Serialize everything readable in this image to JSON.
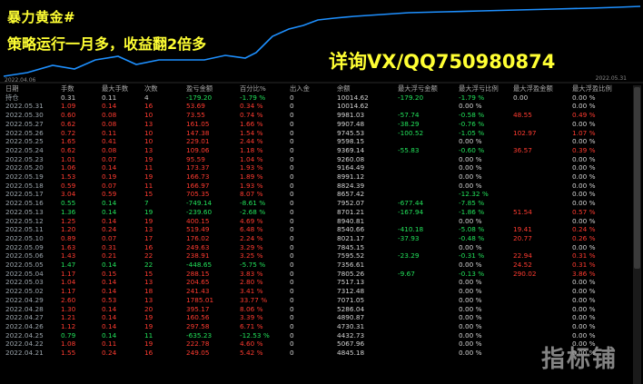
{
  "chart": {
    "title": "暴力黄金#",
    "subtitle": "策略运行一月多，收益翻2倍多",
    "contact": "详询VX/QQ750980874",
    "date_start": "2022.04.06",
    "date_end": "2022.05.31"
  },
  "table": {
    "headers": [
      "日期",
      "手数",
      "最大手数",
      "次数",
      "盈亏金额",
      "百分比%",
      "出入金",
      "余额",
      "最大浮亏金额",
      "最大浮亏比例",
      "最大浮盈金额",
      "最大浮盈比例"
    ],
    "rows": [
      [
        "持仓",
        "0.31",
        "0.11",
        "4",
        "-179.20",
        "-1.79 %",
        "0",
        "10014.62",
        "-179.20",
        "-1.79 %",
        "0.00",
        "0.00 %"
      ],
      [
        "2022.05.31",
        "1.09",
        "0.14",
        "16",
        "53.69",
        "0.34 %",
        "0",
        "10014.62",
        "",
        "0.00 %",
        "",
        "0.00 %"
      ],
      [
        "2022.05.30",
        "0.60",
        "0.08",
        "10",
        "73.55",
        "0.74 %",
        "0",
        "9981.03",
        "-57.74",
        "-0.58 %",
        "48.55",
        "0.49 %"
      ],
      [
        "2022.05.27",
        "0.62",
        "0.08",
        "13",
        "161.05",
        "1.66 %",
        "0",
        "9907.48",
        "-38.29",
        "-0.76 %",
        "",
        "0.00 %"
      ],
      [
        "2022.05.26",
        "0.72",
        "0.11",
        "10",
        "147.38",
        "1.54 %",
        "0",
        "9745.53",
        "-100.52",
        "-1.05 %",
        "102.97",
        "1.07 %"
      ],
      [
        "2022.05.25",
        "1.65",
        "0.41",
        "10",
        "229.01",
        "2.44 %",
        "0",
        "9598.15",
        "",
        "0.00 %",
        "",
        "0.00 %"
      ],
      [
        "2022.05.24",
        "0.62",
        "0.08",
        "13",
        "109.06",
        "1.18 %",
        "0",
        "9369.14",
        "-55.83",
        "-0.60 %",
        "36.57",
        "0.39 %"
      ],
      [
        "2022.05.23",
        "1.01",
        "0.07",
        "19",
        "95.59",
        "1.04 %",
        "0",
        "9260.08",
        "",
        "0.00 %",
        "",
        "0.00 %"
      ],
      [
        "2022.05.20",
        "1.06",
        "0.14",
        "11",
        "173.37",
        "1.93 %",
        "0",
        "9164.49",
        "",
        "0.00 %",
        "",
        "0.00 %"
      ],
      [
        "2022.05.19",
        "1.53",
        "0.19",
        "19",
        "166.73",
        "1.89 %",
        "0",
        "8991.12",
        "",
        "0.00 %",
        "",
        "0.00 %"
      ],
      [
        "2022.05.18",
        "0.59",
        "0.07",
        "11",
        "166.97",
        "1.93 %",
        "0",
        "8824.39",
        "",
        "0.00 %",
        "",
        "0.00 %"
      ],
      [
        "2022.05.17",
        "3.04",
        "0.59",
        "15",
        "705.35",
        "8.07 %",
        "0",
        "8657.42",
        "",
        "-12.32 %",
        "",
        "0.00 %"
      ],
      [
        "2022.05.16",
        "0.55",
        "0.14",
        "7",
        "-749.14",
        "-8.61 %",
        "0",
        "7952.07",
        "-677.44",
        "-7.85 %",
        "",
        "0.00 %"
      ],
      [
        "2022.05.13",
        "1.36",
        "0.14",
        "19",
        "-239.60",
        "-2.68 %",
        "0",
        "8701.21",
        "-167.94",
        "-1.86 %",
        "51.54",
        "0.57 %"
      ],
      [
        "2022.05.12",
        "1.25",
        "0.14",
        "19",
        "400.15",
        "4.69 %",
        "0",
        "8940.81",
        "",
        "0.00 %",
        "",
        "0.00 %"
      ],
      [
        "2022.05.11",
        "1.20",
        "0.24",
        "13",
        "519.49",
        "6.48 %",
        "0",
        "8540.66",
        "-410.18",
        "-5.08 %",
        "19.41",
        "0.24 %"
      ],
      [
        "2022.05.10",
        "0.89",
        "0.07",
        "17",
        "176.02",
        "2.24 %",
        "0",
        "8021.17",
        "-37.93",
        "-0.48 %",
        "20.77",
        "0.26 %"
      ],
      [
        "2022.05.09",
        "1.63",
        "0.31",
        "16",
        "249.63",
        "3.29 %",
        "0",
        "7845.15",
        "",
        "0.00 %",
        "",
        "0.00 %"
      ],
      [
        "2022.05.06",
        "1.43",
        "0.21",
        "22",
        "238.91",
        "3.25 %",
        "0",
        "7595.52",
        "-23.29",
        "-0.31 %",
        "22.94",
        "0.31 %"
      ],
      [
        "2022.05.05",
        "1.47",
        "0.14",
        "22",
        "-448.65",
        "-5.75 %",
        "0",
        "7356.61",
        "",
        "0.00 %",
        "24.52",
        "0.31 %"
      ],
      [
        "2022.05.04",
        "1.17",
        "0.15",
        "15",
        "288.15",
        "3.83 %",
        "0",
        "7805.26",
        "-9.67",
        "-0.13 %",
        "290.02",
        "3.86 %"
      ],
      [
        "2022.05.03",
        "1.04",
        "0.14",
        "13",
        "204.65",
        "2.80 %",
        "0",
        "7517.13",
        "",
        "0.00 %",
        "",
        "0.00 %"
      ],
      [
        "2022.05.02",
        "1.17",
        "0.14",
        "18",
        "241.43",
        "3.41 %",
        "0",
        "7312.48",
        "",
        "0.00 %",
        "",
        "0.00 %"
      ],
      [
        "2022.04.29",
        "2.60",
        "0.53",
        "13",
        "1785.01",
        "33.77 %",
        "0",
        "7071.05",
        "",
        "0.00 %",
        "",
        "0.00 %"
      ],
      [
        "2022.04.28",
        "1.30",
        "0.14",
        "20",
        "395.17",
        "8.06 %",
        "0",
        "5286.04",
        "",
        "0.00 %",
        "",
        "0.00 %"
      ],
      [
        "2022.04.27",
        "1.21",
        "0.14",
        "19",
        "160.56",
        "3.39 %",
        "0",
        "4890.87",
        "",
        "0.00 %",
        "",
        "0.00 %"
      ],
      [
        "2022.04.26",
        "1.12",
        "0.14",
        "19",
        "297.58",
        "6.71 %",
        "0",
        "4730.31",
        "",
        "0.00 %",
        "",
        "0.00 %"
      ],
      [
        "2022.04.25",
        "0.79",
        "0.14",
        "11",
        "-635.23",
        "-12.53 %",
        "0",
        "4432.73",
        "",
        "0.00 %",
        "",
        "0.00 %"
      ],
      [
        "2022.04.22",
        "1.08",
        "0.11",
        "19",
        "222.78",
        "4.60 %",
        "0",
        "5067.96",
        "",
        "0.00 %",
        "",
        "0.00 %"
      ],
      [
        "2022.04.21",
        "1.55",
        "0.24",
        "16",
        "249.05",
        "5.42 %",
        "0",
        "4845.18",
        "",
        "0.00 %",
        "",
        "0.00 %"
      ]
    ]
  },
  "colors": {
    "profit": "#ff3b30",
    "loss": "#22e05a",
    "curve": "#1e90ff",
    "highlight": "#ffff33"
  },
  "watermark": {
    "text": "指标铺"
  }
}
